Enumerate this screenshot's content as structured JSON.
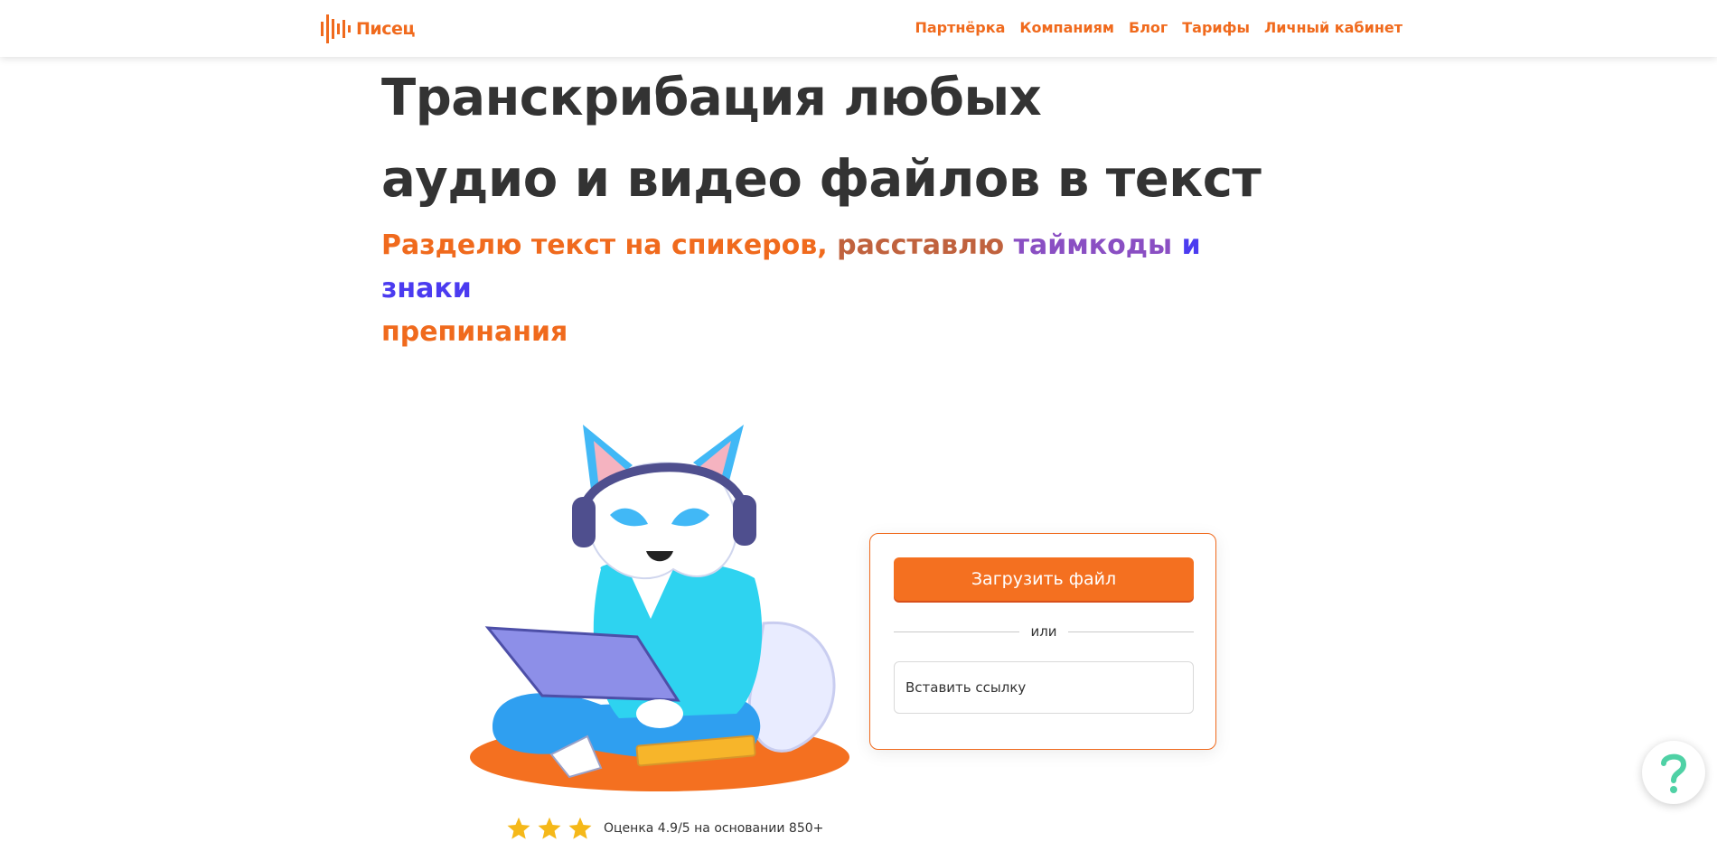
{
  "header": {
    "logo_text": "Писец",
    "nav": [
      {
        "label": "Партнёрка"
      },
      {
        "label": "Компаниям"
      },
      {
        "label": "Блог"
      },
      {
        "label": "Тарифы"
      },
      {
        "label": "Личный кабинет"
      }
    ]
  },
  "hero": {
    "title_line1": "Транскрибация любых",
    "title_line2": "аудио и видео файлов в текст",
    "subtitle": {
      "part1": "Разделю текст на спикеров,",
      "part2": "расставлю",
      "part3": "таймкоды",
      "part4": "и знаки",
      "part5": "препинания"
    }
  },
  "upload": {
    "button_label": "Загрузить файл",
    "or_label": "или",
    "link_placeholder": "Вставить ссылку"
  },
  "rating": {
    "text": "Оценка 4.9/5 на основании 850+",
    "stars_visible": 3
  },
  "colors": {
    "accent": "#f06a1d",
    "button": "#f47020",
    "heading": "#333333",
    "help_icon": "#4fd1a5"
  },
  "icons": {
    "logo": "sound-wave-logo-icon",
    "help": "question-mark-icon",
    "star": "star-icon"
  }
}
